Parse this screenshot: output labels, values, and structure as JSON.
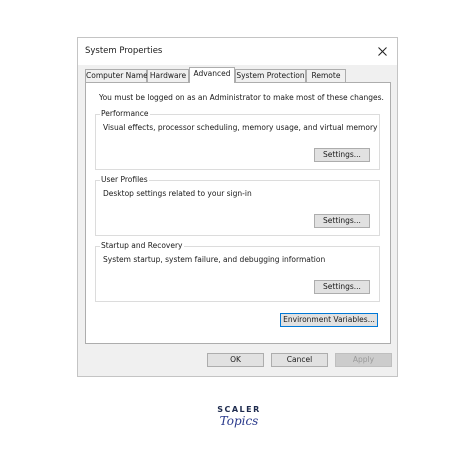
{
  "window": {
    "title": "System Properties"
  },
  "tabs": [
    "Computer Name",
    "Hardware",
    "Advanced",
    "System Protection",
    "Remote"
  ],
  "active_tab": "Advanced",
  "notice": "You must be logged on as an Administrator to make most of these changes.",
  "groups": {
    "performance": {
      "label": "Performance",
      "description": "Visual effects, processor scheduling, memory usage, and virtual memory",
      "button": "Settings..."
    },
    "user_profiles": {
      "label": "User Profiles",
      "description": "Desktop settings related to your sign-in",
      "button": "Settings..."
    },
    "startup": {
      "label": "Startup and Recovery",
      "description": "System startup, system failure, and debugging information",
      "button": "Settings..."
    }
  },
  "env_button": "Environment Variables...",
  "footer": {
    "ok": "OK",
    "cancel": "Cancel",
    "apply": "Apply"
  },
  "logo": {
    "top": "SCALER",
    "bottom": "Topics"
  },
  "colors": {
    "accent": "#0078d7",
    "dialog_bg": "#f0f0f0",
    "logo": "#2a3a8c"
  }
}
